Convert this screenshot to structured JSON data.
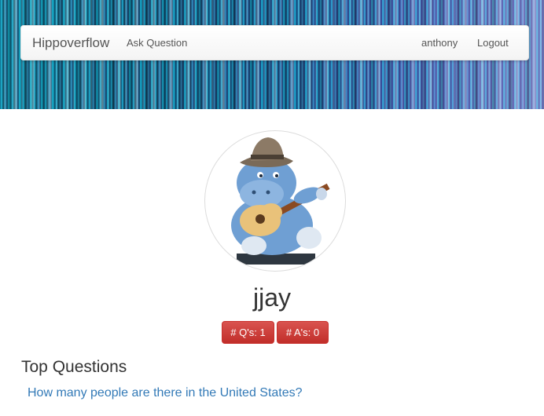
{
  "navbar": {
    "brand": "Hippoverflow",
    "ask_label": "Ask Question",
    "user_label": "anthony",
    "logout_label": "Logout"
  },
  "profile": {
    "avatar_icon": "hippo-guitar-avatar",
    "username": "jjay",
    "questions_badge": "# Q's: 1",
    "answers_badge": "# A's: 0"
  },
  "top_questions": {
    "title": "Top Questions",
    "items": [
      {
        "label": "How many people are there in the United States?"
      }
    ]
  },
  "colors": {
    "badge": "#d9534f",
    "link": "#337ab7"
  }
}
